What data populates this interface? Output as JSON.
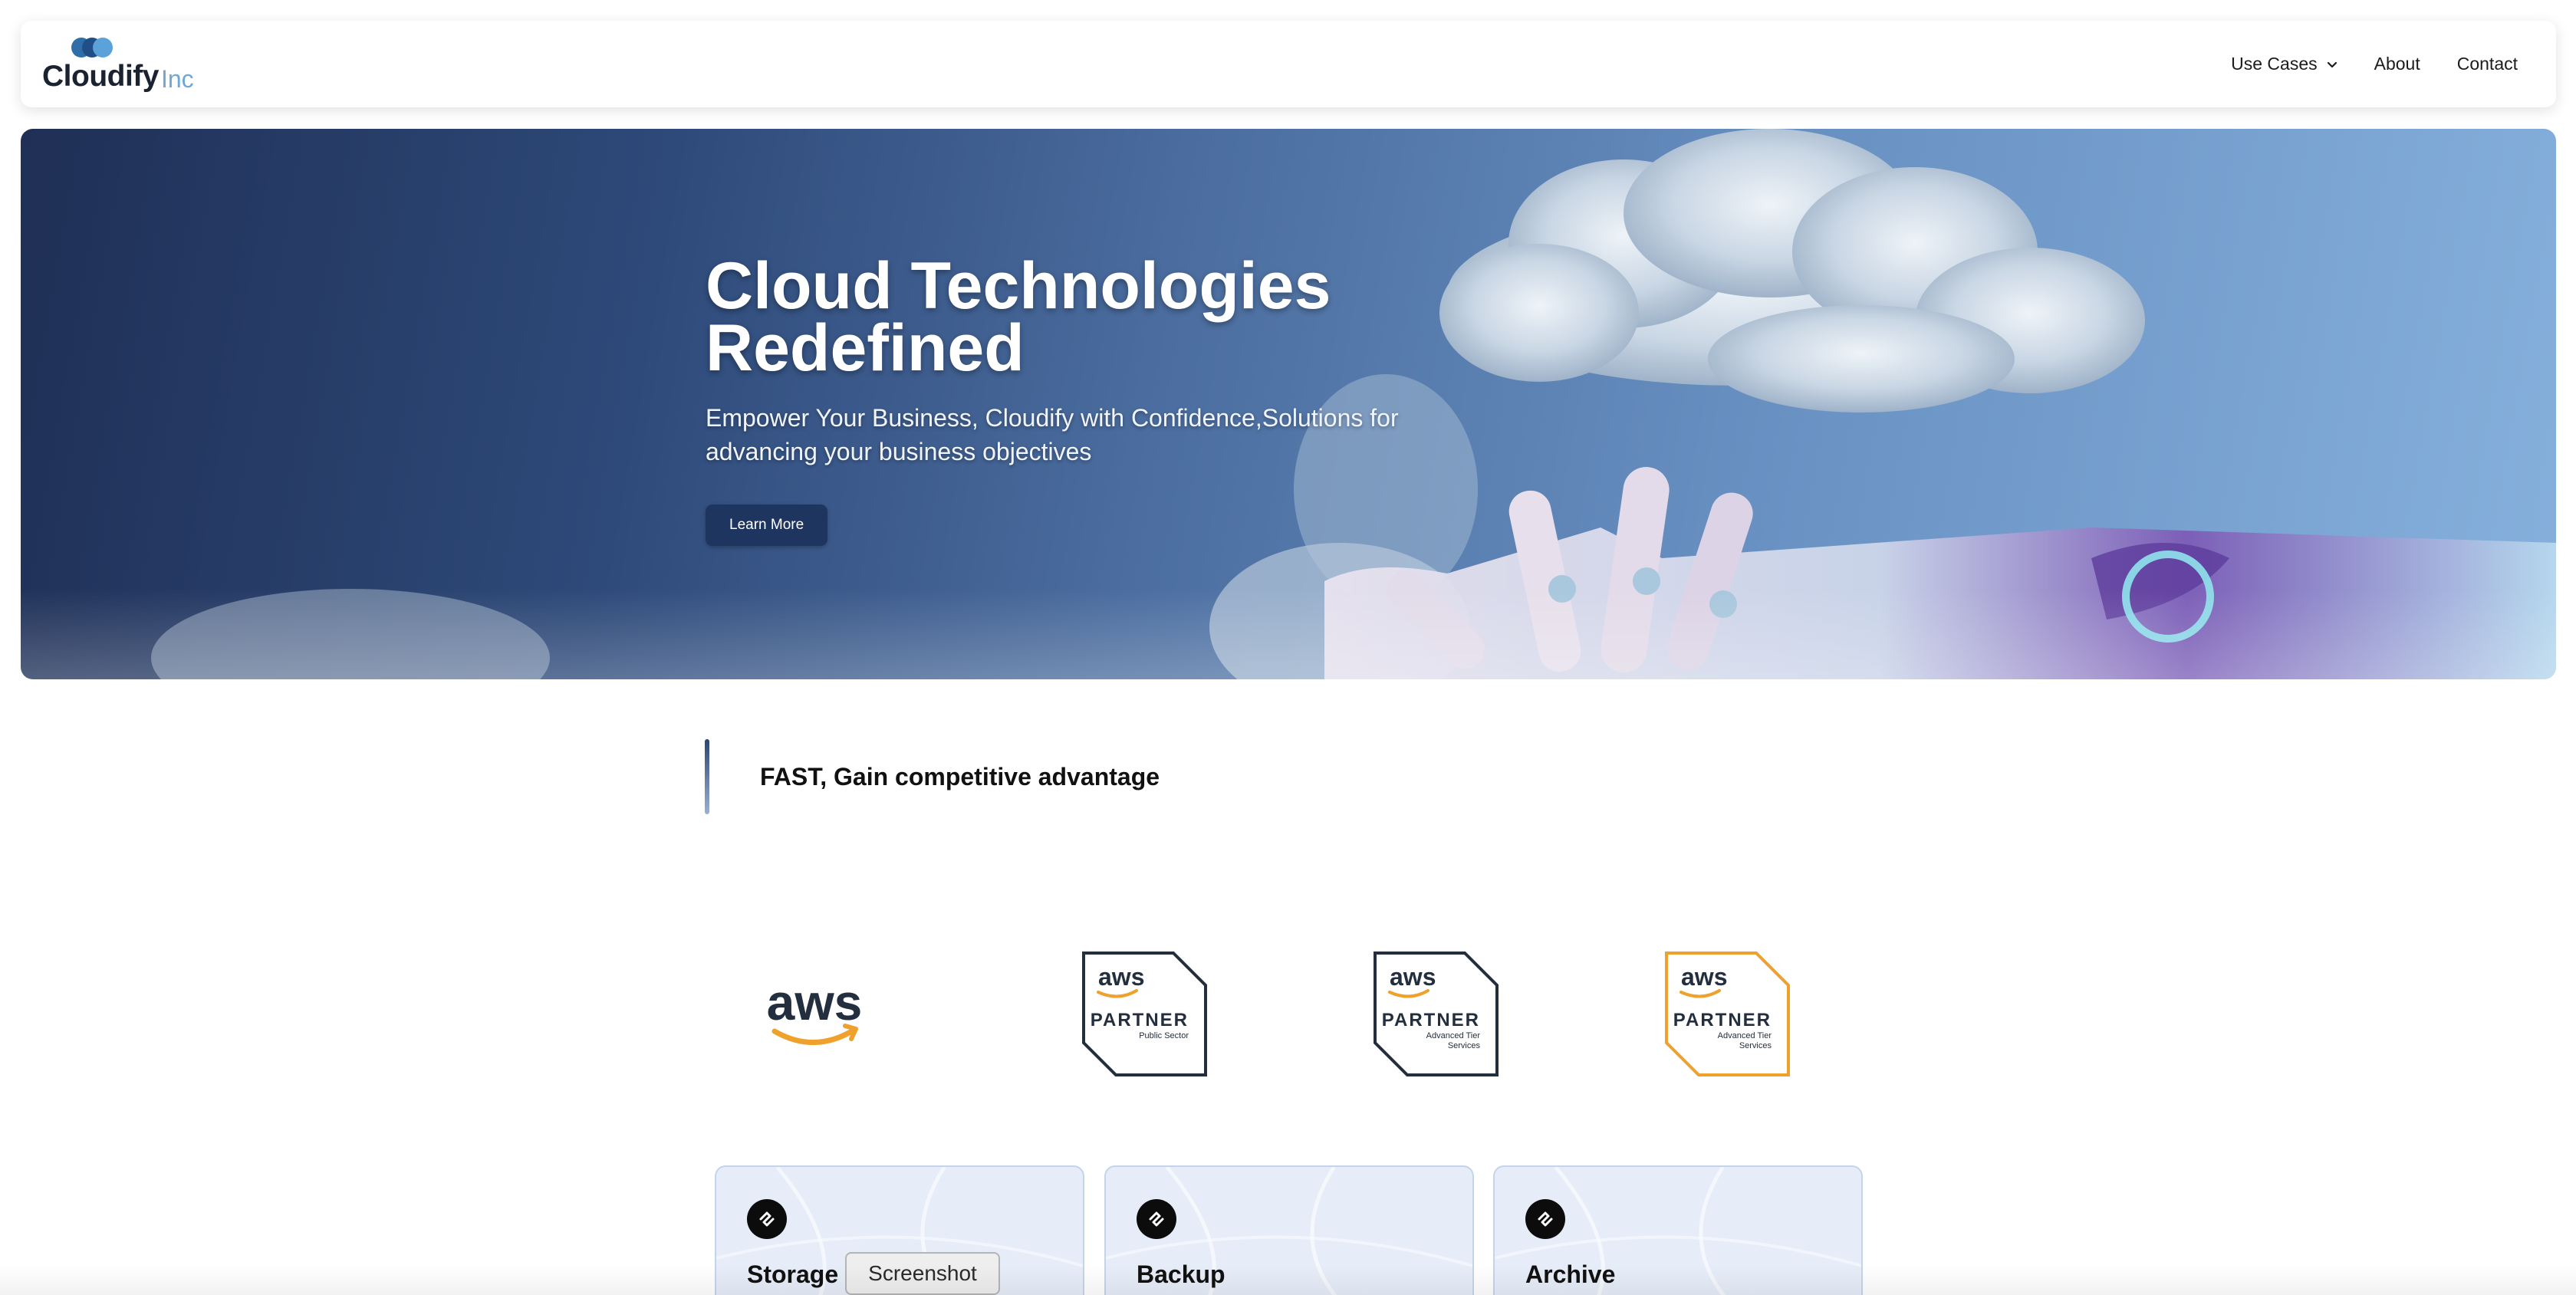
{
  "brand": {
    "name": "Cloudify",
    "suffix": "Inc"
  },
  "nav": {
    "use_cases": "Use Cases",
    "about": "About",
    "contact": "Contact"
  },
  "hero": {
    "title_line1": "Cloud Technologies",
    "title_line2": "Redefined",
    "subtitle_line1": "Empower Your Business, Cloudify with Confidence,Solutions for",
    "subtitle_line2": "advancing your business objectives",
    "cta": "Learn More"
  },
  "tagline": {
    "text": "FAST, Gain competitive advantage"
  },
  "partners": [
    {
      "icon": "aws-logo",
      "wordmark": "aws"
    },
    {
      "icon": "aws-partner-badge",
      "wordmark": "aws",
      "title": "PARTNER",
      "tier_line1": "Public Sector",
      "tier_line2": "",
      "color": "#232f3e"
    },
    {
      "icon": "aws-partner-badge",
      "wordmark": "aws",
      "title": "PARTNER",
      "tier_line1": "Advanced Tier",
      "tier_line2": "Services",
      "color": "#232f3e"
    },
    {
      "icon": "aws-partner-badge",
      "wordmark": "aws",
      "title": "PARTNER",
      "tier_line1": "Advanced Tier",
      "tier_line2": "Services",
      "color": "#f0a12b"
    }
  ],
  "cards": [
    {
      "title": "Storage",
      "icon": "link-icon"
    },
    {
      "title": "Backup",
      "icon": "link-icon"
    },
    {
      "title": "Archive",
      "icon": "link-icon"
    }
  ],
  "tooltip": {
    "text": "Screenshot"
  },
  "colors": {
    "accent": "#1e3560",
    "aws_orange": "#f0a12b",
    "aws_dark": "#232f3e",
    "logo_blue": "#6fa8d8"
  }
}
